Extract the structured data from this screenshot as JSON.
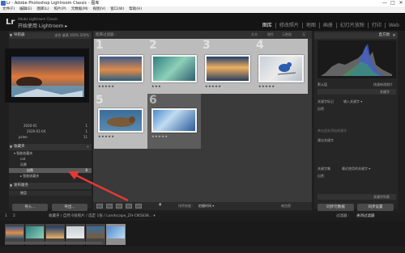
{
  "window": {
    "title": "Lr - Adobe Photoshop Lightroom Classic - 图库",
    "controls": [
      "—",
      "□",
      "✕"
    ]
  },
  "menu": [
    "文件(F)",
    "编辑(E)",
    "图库(L)",
    "照片(P)",
    "元数据(M)",
    "视图(V)",
    "窗口(W)",
    "帮助(H)"
  ],
  "identity": {
    "logo": "Lr",
    "line1": "Adobe Lightroom Classic",
    "line2": "开始使用 Lightroom ▸"
  },
  "modules": [
    "图库",
    "修改照片",
    "地图",
    "画册",
    "幻灯片放映",
    "打印",
    "Web"
  ],
  "active_module": "图库",
  "left_panel": {
    "navigator": "导航器",
    "navigator_opts": "适合  填满  100%  200%",
    "folders": [
      {
        "label": "2020-01",
        "count": "1"
      },
      {
        "label": "2020-01-04",
        "count": "1"
      },
      {
        "label": "pslee",
        "count": "11"
      }
    ],
    "collections_header": "收藏夹",
    "collection_items": [
      {
        "label": "▾ 智能收藏夹",
        "count": ""
      },
      {
        "label": "cat",
        "count": ""
      },
      {
        "label": "风景",
        "count": ""
      },
      {
        "label": "自然",
        "count": "6",
        "selected": true
      },
      {
        "label": "▸ 智能收藏夹",
        "count": ""
      }
    ],
    "publish_header": "发布服务",
    "publish_item": "硬盘",
    "import_button": "导入...",
    "export_button": "导出..."
  },
  "filter_bar": {
    "title": "图库过滤器 :",
    "options": [
      "文本",
      "属性",
      "元数据",
      "无"
    ]
  },
  "grid": {
    "cells": [
      {
        "num": "1",
        "stars": "★★★★★"
      },
      {
        "num": "2",
        "stars": "★★★"
      },
      {
        "num": "3",
        "stars": "★★★★★"
      },
      {
        "num": "4",
        "stars": "★★★★★"
      },
      {
        "num": "5",
        "stars": "★★★★★"
      },
      {
        "num": "6",
        "stars": "★★★★★"
      }
    ]
  },
  "toolbar": {
    "sort_label": "排序依据 :",
    "sort_value": "拍摄时间 ▾",
    "thumbnails_label": "缩览图"
  },
  "right_panel": {
    "histogram": "直方图",
    "quick_develop": "快速修改照片",
    "keywording": "关键字",
    "keyword_tags_label": "关键字标记",
    "keyword_tags_value": "输入关键字 ▾",
    "keyword_value": "自然",
    "click_here": "单击此处添加关键字",
    "suggestions": "建议关键字",
    "keyword_set": "关键字集",
    "keyword_set_value": "最近使用的关键字 ▾",
    "keyword_list": "关键字列表",
    "metadata": "元数据",
    "sync_button": "同步元数据",
    "sync_settings_button": "同步设置",
    "custom_label": "默认值"
  },
  "bottom": {
    "pages": [
      "1",
      "2"
    ],
    "path": "收藏夹 / 自然  6张照片 / 选定 1张 / Landscape_ZH-CN5838... ▾",
    "filter_label": "过滤器 :",
    "filter_value": "关闭过滤器"
  },
  "colors": {
    "accent_arrow": "#e53935"
  }
}
